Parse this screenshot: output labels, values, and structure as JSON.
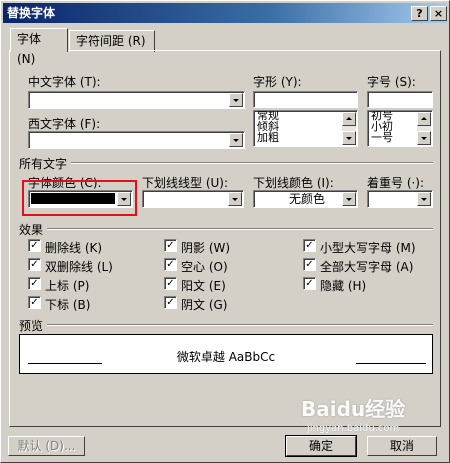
{
  "window": {
    "title": "替换字体"
  },
  "title_buttons": {
    "help": "?",
    "close": "×"
  },
  "tabs": [
    {
      "label": "字体 (N)",
      "active": true
    },
    {
      "label": "字符间距 (R)",
      "active": false
    }
  ],
  "font": {
    "chinese_label": "中文字体 (T):",
    "chinese_value": "",
    "western_label": "西文字体 (F):",
    "western_value": "",
    "style_label": "字形 (Y):",
    "style_value": "",
    "style_options": [
      "常规",
      "倾斜",
      "加粗"
    ],
    "size_label": "字号 (S):",
    "size_value": "",
    "size_options": [
      "初号",
      "小初",
      "一号"
    ]
  },
  "all_text": {
    "section_label": "所有文字",
    "color_label": "字体颜色 (C):",
    "color_value": "#000000",
    "underline_label": "下划线线型 (U):",
    "underline_value": "",
    "underline_color_label": "下划线颜色 (I):",
    "underline_color_value": "无颜色",
    "emphasis_label": "着重号 (·):",
    "emphasis_value": ""
  },
  "effects": {
    "section_label": "效果",
    "col1": [
      "删除线 (K)",
      "双删除线 (L)",
      "上标 (P)",
      "下标 (B)"
    ],
    "col2": [
      "阴影 (W)",
      "空心 (O)",
      "阳文 (E)",
      "阴文 (G)"
    ],
    "col3": [
      "小型大写字母 (M)",
      "全部大写字母 (A)",
      "隐藏 (H)"
    ]
  },
  "preview": {
    "section_label": "预览",
    "sample_text": "微软卓越  AaBbCc"
  },
  "buttons": {
    "default_label": "默认 (D)...",
    "ok_label": "确定",
    "cancel_label": "取消"
  },
  "watermark": {
    "text": "Baidu经验",
    "sub": "jingyan.baidu.com"
  },
  "colors": {
    "highlight_box": "#e0101c",
    "titlebar": "#0a246a"
  }
}
